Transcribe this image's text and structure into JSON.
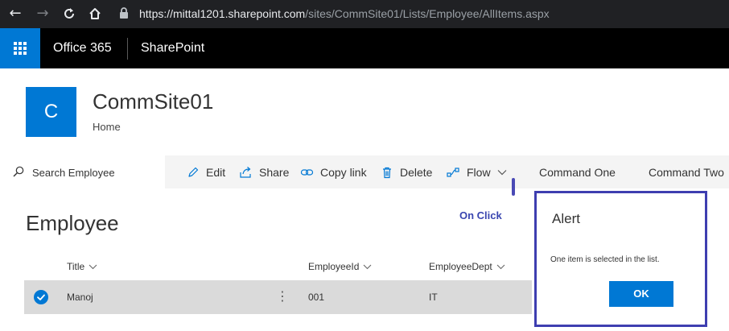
{
  "browser": {
    "url_domain": "https://mittal1201.sharepoint.com",
    "url_path": "/sites/CommSite01/Lists/Employee/AllItems.aspx"
  },
  "suite": {
    "app_name": "Office 365",
    "product_name": "SharePoint",
    "accent_color": "#0078d4"
  },
  "site": {
    "logo_letter": "C",
    "title": "CommSite01",
    "nav_home": "Home"
  },
  "command_bar": {
    "search_placeholder": "Search Employee",
    "edit": "Edit",
    "share": "Share",
    "copy_link": "Copy link",
    "delete": "Delete",
    "flow": "Flow",
    "command_one": "Command One",
    "command_two": "Command Two"
  },
  "list": {
    "title": "Employee",
    "on_click_label": "On Click",
    "columns": [
      "Title",
      "EmployeeId",
      "EmployeeDept"
    ],
    "rows": [
      {
        "title": "Manoj",
        "employee_id": "001",
        "employee_dept": "IT",
        "selected": true
      }
    ]
  },
  "dialog": {
    "title": "Alert",
    "message": "One item is selected in the list.",
    "ok_label": "OK",
    "border_color": "#3e3eb0"
  }
}
